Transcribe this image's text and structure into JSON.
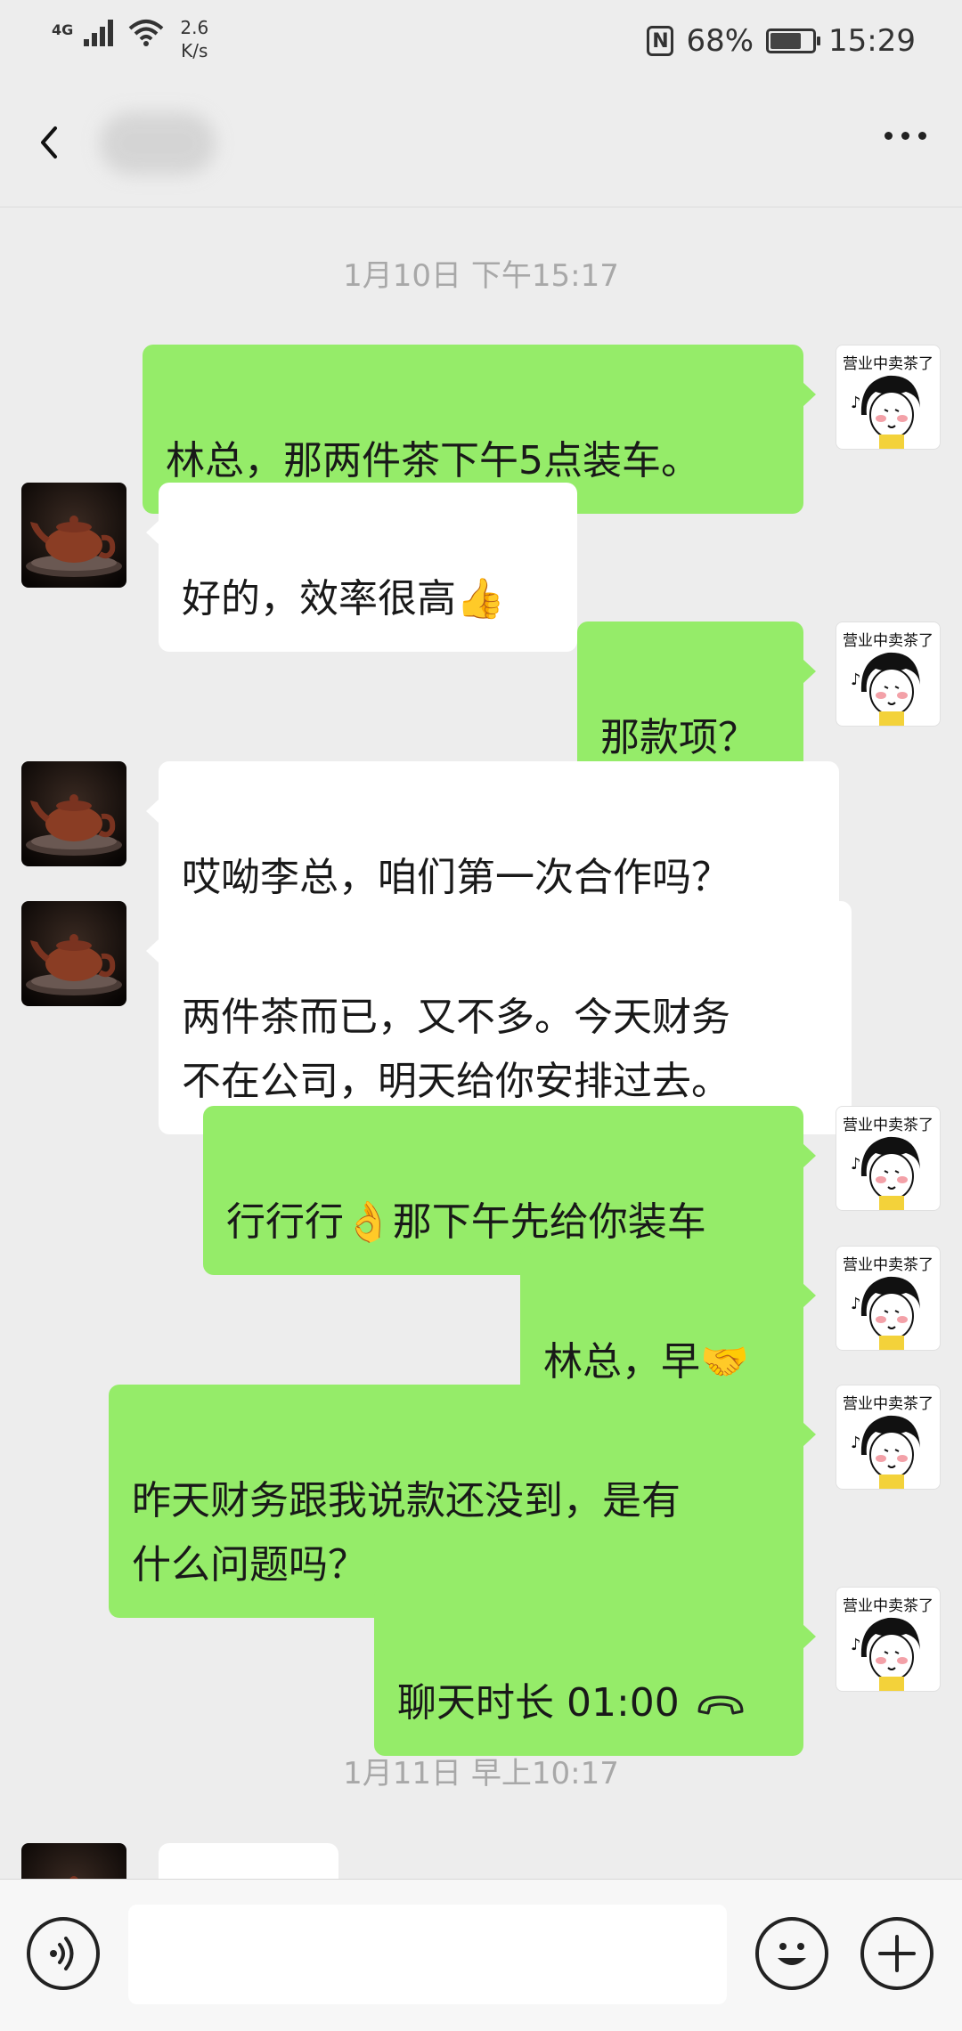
{
  "status_bar": {
    "network_type": "4G",
    "speed_value": "2.6",
    "speed_unit": "K/s",
    "battery_percent": "68%",
    "time": "15:29",
    "icons": [
      "signal-icon",
      "wifi-icon",
      "nfc-icon",
      "battery-icon"
    ]
  },
  "header": {
    "back_icon": "chevron-left-icon",
    "more_icon": "more-dots-icon"
  },
  "timestamps": [
    "1月10日 下午15:17",
    "1月11日 早上10:17"
  ],
  "sticker_caption": "营业中卖茶了",
  "messages": [
    {
      "side": "right",
      "text": "林总，那两件茶下午5点装车。"
    },
    {
      "side": "left",
      "text": "好的，效率很高",
      "emoji": "👍"
    },
    {
      "side": "right",
      "text": "那款项？"
    },
    {
      "side": "left",
      "text": "哎呦李总，咱们第一次合作吗？"
    },
    {
      "side": "left",
      "text": "两件茶而已，又不多。今天财务\n不在公司，明天给你安排过去。"
    },
    {
      "side": "right",
      "text_before": "行行行",
      "emoji": "👌",
      "text_after": "那下午先给你装车"
    },
    {
      "side": "right",
      "text": "林总，早",
      "emoji": "🤝"
    },
    {
      "side": "right",
      "text": "昨天财务跟我说款还没到，是有\n什么问题吗？"
    },
    {
      "side": "right",
      "text": "聊天时长 01:00",
      "icon": "phone-hangup-icon"
    },
    {
      "side": "left",
      "text": ""
    }
  ],
  "input_bar": {
    "placeholder": "",
    "icons": [
      "voice-icon",
      "emoji-smile-icon",
      "plus-icon"
    ]
  },
  "colors": {
    "background": "#ededed",
    "bubble_self": "#95ec69",
    "bubble_other": "#ffffff",
    "timestamp_text": "#a8a8a8"
  }
}
